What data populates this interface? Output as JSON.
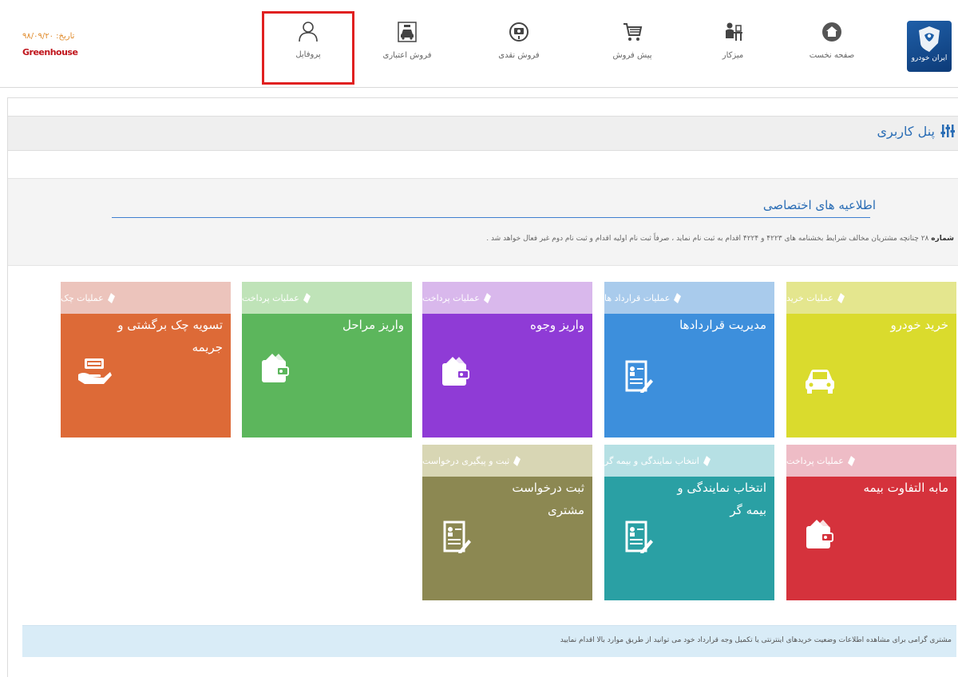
{
  "header": {
    "logo_text": "ایران خودرو",
    "date": "تاریخ: ۹۸/۰۹/۲۰",
    "user_name": "Greenhouse",
    "nav": [
      {
        "label": "صفحه نخست",
        "icon": "home-icon"
      },
      {
        "label": "میزکار",
        "icon": "desk-user-icon"
      },
      {
        "label": "پیش فروش",
        "icon": "cart-icon"
      },
      {
        "label": "فروش نقدی",
        "icon": "money-icon"
      },
      {
        "label": "فروش اعتباری",
        "icon": "car-sale-icon"
      },
      {
        "label": "پروفایل",
        "icon": "user-icon"
      }
    ]
  },
  "panel": {
    "title": "پنل کاربری"
  },
  "notice": {
    "title": "اطلاعیه های اختصاصی",
    "number_label": "شماره",
    "number": "۲۸",
    "text": "چنانچه مشتریان مخالف شرایط بخشنامه های ۴۲۲۳ و ۴۲۲۴ اقدام به ثبت نام نماید ، صرفاً ثبت نام اولیه اقدام و ثبت نام دوم غیر فعال خواهد شد ."
  },
  "tiles": [
    {
      "header": "عملیات خرید",
      "label": "خرید خودرو",
      "icon": "car-icon",
      "header_color": "#e4e68e",
      "body_color": "#dadb2d"
    },
    {
      "header": "عملیات قرارداد ها",
      "label": "مدیریت قراردادها",
      "icon": "document-edit-icon",
      "header_color": "#a9cbec",
      "body_color": "#3d8fdc"
    },
    {
      "header": "عملیات پرداخت",
      "label": "واریز وجوه",
      "icon": "wallet-icon",
      "header_color": "#d9b8ec",
      "body_color": "#8f3bd6"
    },
    {
      "header": "عملیات پرداخت",
      "label": "واریز مراحل",
      "icon": "wallet-icon",
      "header_color": "#bfe3b8",
      "body_color": "#5cb65c"
    },
    {
      "header": "عملیات چک",
      "label": "تسویه چک برگشتی و جریمه",
      "icon": "hand-cash-icon",
      "header_color": "#ecc4bc",
      "body_color": "#dd6a37"
    },
    {
      "header": "عملیات پرداخت",
      "label": "مابه التفاوت بیمه",
      "icon": "wallet-icon",
      "header_color": "#eebcc6",
      "body_color": "#d5323c"
    },
    {
      "header": "انتخاب نمایندگی و بیمه گر",
      "label": "انتخاب نمایندگی و بیمه گر",
      "icon": "document-edit-icon",
      "header_color": "#b6e0e4",
      "body_color": "#2aa0a4"
    },
    {
      "header": "ثبت و پیگیری درخواست",
      "label": "ثبت درخواست مشتری",
      "icon": "document-edit-icon",
      "header_color": "#d8d6b4",
      "body_color": "#8c8852"
    }
  ],
  "footer": {
    "text": "مشتری گرامی برای مشاهده اطلاعات وضعیت خریدهای اینترنتی یا تکمیل وجه قرارداد خود می توانید از طریق موارد بالا اقدام نمایید"
  }
}
